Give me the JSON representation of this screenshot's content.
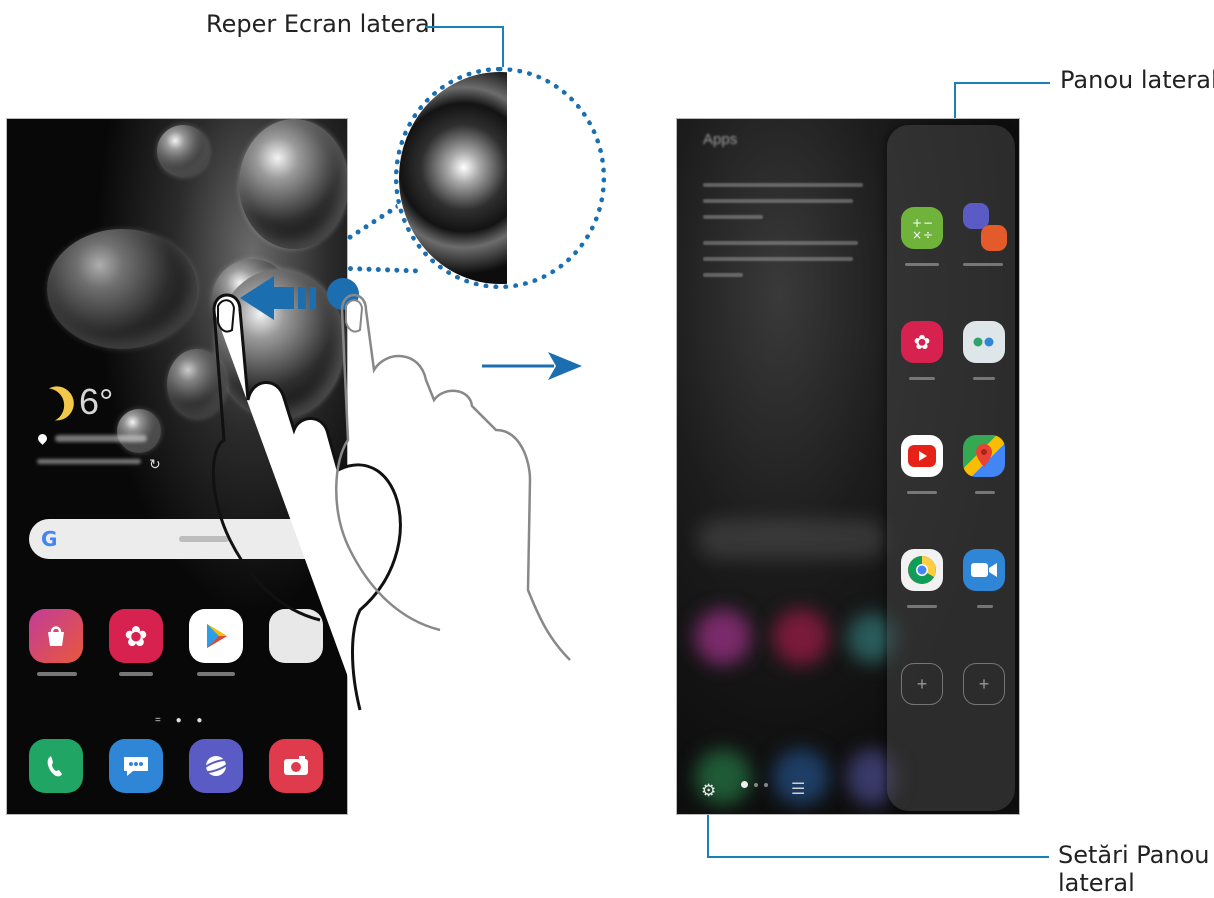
{
  "callouts": {
    "edge_handle": "Reper Ecran lateral",
    "edge_panel": "Panou lateral",
    "edge_panel_settings_line1": "Setări Panou",
    "edge_panel_settings_line2": "lateral"
  },
  "home_screen": {
    "weather_temp": "6°",
    "search_logo": "G",
    "page_indicator": "= ● ●",
    "apps_row": [
      "shopping-bag-icon",
      "flower-gallery-icon",
      "play-store-icon",
      "google-folder-icon"
    ],
    "dock": [
      "phone-icon",
      "messages-icon",
      "internet-icon",
      "camera-icon"
    ]
  },
  "edge_screen": {
    "panel_title": "Apps",
    "settings_icon": "⚙",
    "list_icon": "☰",
    "panel_apps": [
      "calculator-icon",
      "internet-note-pair-icon",
      "gallery-icon",
      "folder-icon",
      "youtube-icon",
      "maps-icon",
      "chrome-icon",
      "duo-icon"
    ],
    "add_slots": [
      "+",
      "+"
    ]
  },
  "colors": {
    "accent": "#1b6fb0",
    "leader_line": "#1b7fb8"
  }
}
